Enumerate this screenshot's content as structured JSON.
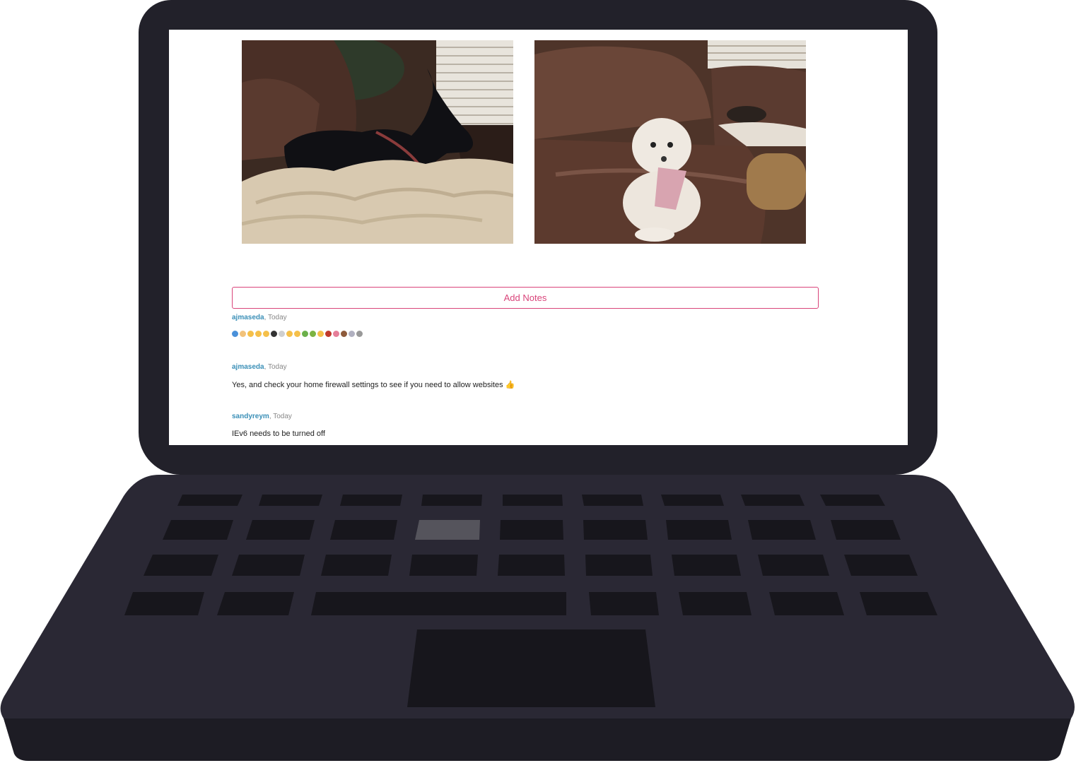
{
  "add_notes_label": "Add Notes",
  "photos": [
    {
      "icon": "dog-on-couch-photo"
    },
    {
      "icon": "poodle-on-couch-photo"
    }
  ],
  "notes": [
    {
      "user": "ajmaseda",
      "sep": ", ",
      "time": "Today",
      "text": "",
      "emoji_icons": true
    },
    {
      "user": "ajmaseda",
      "sep": ", ",
      "time": "Today",
      "text": "Yes, and check your home firewall settings to see if you need to allow websites 👍"
    },
    {
      "user": "sandyreym",
      "sep": ", ",
      "time": "Today",
      "text": "IEv6 needs to be turned off"
    }
  ],
  "colors": {
    "accent": "#d9447a",
    "username": "#3a8fb7",
    "laptop": "#22212a",
    "laptop_base": "#2a2834"
  }
}
